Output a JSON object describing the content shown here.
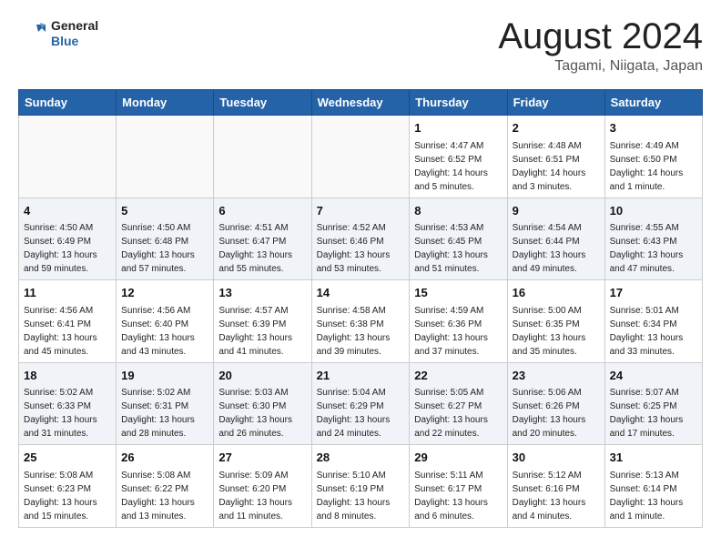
{
  "header": {
    "logo_line1": "General",
    "logo_line2": "Blue",
    "month": "August 2024",
    "location": "Tagami, Niigata, Japan"
  },
  "weekdays": [
    "Sunday",
    "Monday",
    "Tuesday",
    "Wednesday",
    "Thursday",
    "Friday",
    "Saturday"
  ],
  "weeks": [
    [
      {
        "day": "",
        "info": ""
      },
      {
        "day": "",
        "info": ""
      },
      {
        "day": "",
        "info": ""
      },
      {
        "day": "",
        "info": ""
      },
      {
        "day": "1",
        "info": "Sunrise: 4:47 AM\nSunset: 6:52 PM\nDaylight: 14 hours\nand 5 minutes."
      },
      {
        "day": "2",
        "info": "Sunrise: 4:48 AM\nSunset: 6:51 PM\nDaylight: 14 hours\nand 3 minutes."
      },
      {
        "day": "3",
        "info": "Sunrise: 4:49 AM\nSunset: 6:50 PM\nDaylight: 14 hours\nand 1 minute."
      }
    ],
    [
      {
        "day": "4",
        "info": "Sunrise: 4:50 AM\nSunset: 6:49 PM\nDaylight: 13 hours\nand 59 minutes."
      },
      {
        "day": "5",
        "info": "Sunrise: 4:50 AM\nSunset: 6:48 PM\nDaylight: 13 hours\nand 57 minutes."
      },
      {
        "day": "6",
        "info": "Sunrise: 4:51 AM\nSunset: 6:47 PM\nDaylight: 13 hours\nand 55 minutes."
      },
      {
        "day": "7",
        "info": "Sunrise: 4:52 AM\nSunset: 6:46 PM\nDaylight: 13 hours\nand 53 minutes."
      },
      {
        "day": "8",
        "info": "Sunrise: 4:53 AM\nSunset: 6:45 PM\nDaylight: 13 hours\nand 51 minutes."
      },
      {
        "day": "9",
        "info": "Sunrise: 4:54 AM\nSunset: 6:44 PM\nDaylight: 13 hours\nand 49 minutes."
      },
      {
        "day": "10",
        "info": "Sunrise: 4:55 AM\nSunset: 6:43 PM\nDaylight: 13 hours\nand 47 minutes."
      }
    ],
    [
      {
        "day": "11",
        "info": "Sunrise: 4:56 AM\nSunset: 6:41 PM\nDaylight: 13 hours\nand 45 minutes."
      },
      {
        "day": "12",
        "info": "Sunrise: 4:56 AM\nSunset: 6:40 PM\nDaylight: 13 hours\nand 43 minutes."
      },
      {
        "day": "13",
        "info": "Sunrise: 4:57 AM\nSunset: 6:39 PM\nDaylight: 13 hours\nand 41 minutes."
      },
      {
        "day": "14",
        "info": "Sunrise: 4:58 AM\nSunset: 6:38 PM\nDaylight: 13 hours\nand 39 minutes."
      },
      {
        "day": "15",
        "info": "Sunrise: 4:59 AM\nSunset: 6:36 PM\nDaylight: 13 hours\nand 37 minutes."
      },
      {
        "day": "16",
        "info": "Sunrise: 5:00 AM\nSunset: 6:35 PM\nDaylight: 13 hours\nand 35 minutes."
      },
      {
        "day": "17",
        "info": "Sunrise: 5:01 AM\nSunset: 6:34 PM\nDaylight: 13 hours\nand 33 minutes."
      }
    ],
    [
      {
        "day": "18",
        "info": "Sunrise: 5:02 AM\nSunset: 6:33 PM\nDaylight: 13 hours\nand 31 minutes."
      },
      {
        "day": "19",
        "info": "Sunrise: 5:02 AM\nSunset: 6:31 PM\nDaylight: 13 hours\nand 28 minutes."
      },
      {
        "day": "20",
        "info": "Sunrise: 5:03 AM\nSunset: 6:30 PM\nDaylight: 13 hours\nand 26 minutes."
      },
      {
        "day": "21",
        "info": "Sunrise: 5:04 AM\nSunset: 6:29 PM\nDaylight: 13 hours\nand 24 minutes."
      },
      {
        "day": "22",
        "info": "Sunrise: 5:05 AM\nSunset: 6:27 PM\nDaylight: 13 hours\nand 22 minutes."
      },
      {
        "day": "23",
        "info": "Sunrise: 5:06 AM\nSunset: 6:26 PM\nDaylight: 13 hours\nand 20 minutes."
      },
      {
        "day": "24",
        "info": "Sunrise: 5:07 AM\nSunset: 6:25 PM\nDaylight: 13 hours\nand 17 minutes."
      }
    ],
    [
      {
        "day": "25",
        "info": "Sunrise: 5:08 AM\nSunset: 6:23 PM\nDaylight: 13 hours\nand 15 minutes."
      },
      {
        "day": "26",
        "info": "Sunrise: 5:08 AM\nSunset: 6:22 PM\nDaylight: 13 hours\nand 13 minutes."
      },
      {
        "day": "27",
        "info": "Sunrise: 5:09 AM\nSunset: 6:20 PM\nDaylight: 13 hours\nand 11 minutes."
      },
      {
        "day": "28",
        "info": "Sunrise: 5:10 AM\nSunset: 6:19 PM\nDaylight: 13 hours\nand 8 minutes."
      },
      {
        "day": "29",
        "info": "Sunrise: 5:11 AM\nSunset: 6:17 PM\nDaylight: 13 hours\nand 6 minutes."
      },
      {
        "day": "30",
        "info": "Sunrise: 5:12 AM\nSunset: 6:16 PM\nDaylight: 13 hours\nand 4 minutes."
      },
      {
        "day": "31",
        "info": "Sunrise: 5:13 AM\nSunset: 6:14 PM\nDaylight: 13 hours\nand 1 minute."
      }
    ]
  ]
}
